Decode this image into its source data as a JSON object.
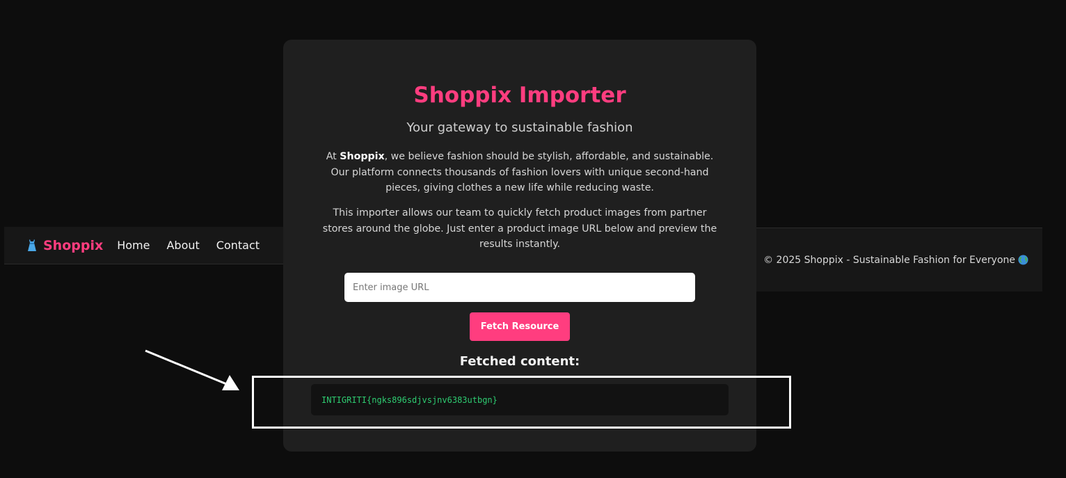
{
  "navbar": {
    "brand": "Shoppix",
    "links": [
      "Home",
      "About",
      "Contact"
    ]
  },
  "card": {
    "title": "Shoppix Importer",
    "subtitle": "Your gateway to sustainable fashion",
    "para1_prefix": "At ",
    "para1_brand": "Shoppix",
    "para1_rest": ", we believe fashion should be stylish, affordable, and sustainable. Our platform connects thousands of fashion lovers with unique second-hand pieces, giving clothes a new life while reducing waste.",
    "para2": "This importer allows our team to quickly fetch product images from partner stores around the globe. Just enter a product image URL below and preview the results instantly.",
    "input_placeholder": "Enter image URL",
    "input_value": "",
    "button_label": "Fetch Resource",
    "fetched_heading": "Fetched content:",
    "fetched_result": "INTIGRITI{ngks896sdjvsjnv6383utbgn}"
  },
  "footer": {
    "text": "© 2025 Shoppix - Sustainable Fashion for Everyone"
  },
  "colors": {
    "accent": "#ff3d7f",
    "background": "#0d0d0d",
    "card": "#1f1f1f",
    "result_text": "#2ecc71"
  },
  "icons": {
    "brand": "dress-icon",
    "footer": "globe-icon"
  }
}
